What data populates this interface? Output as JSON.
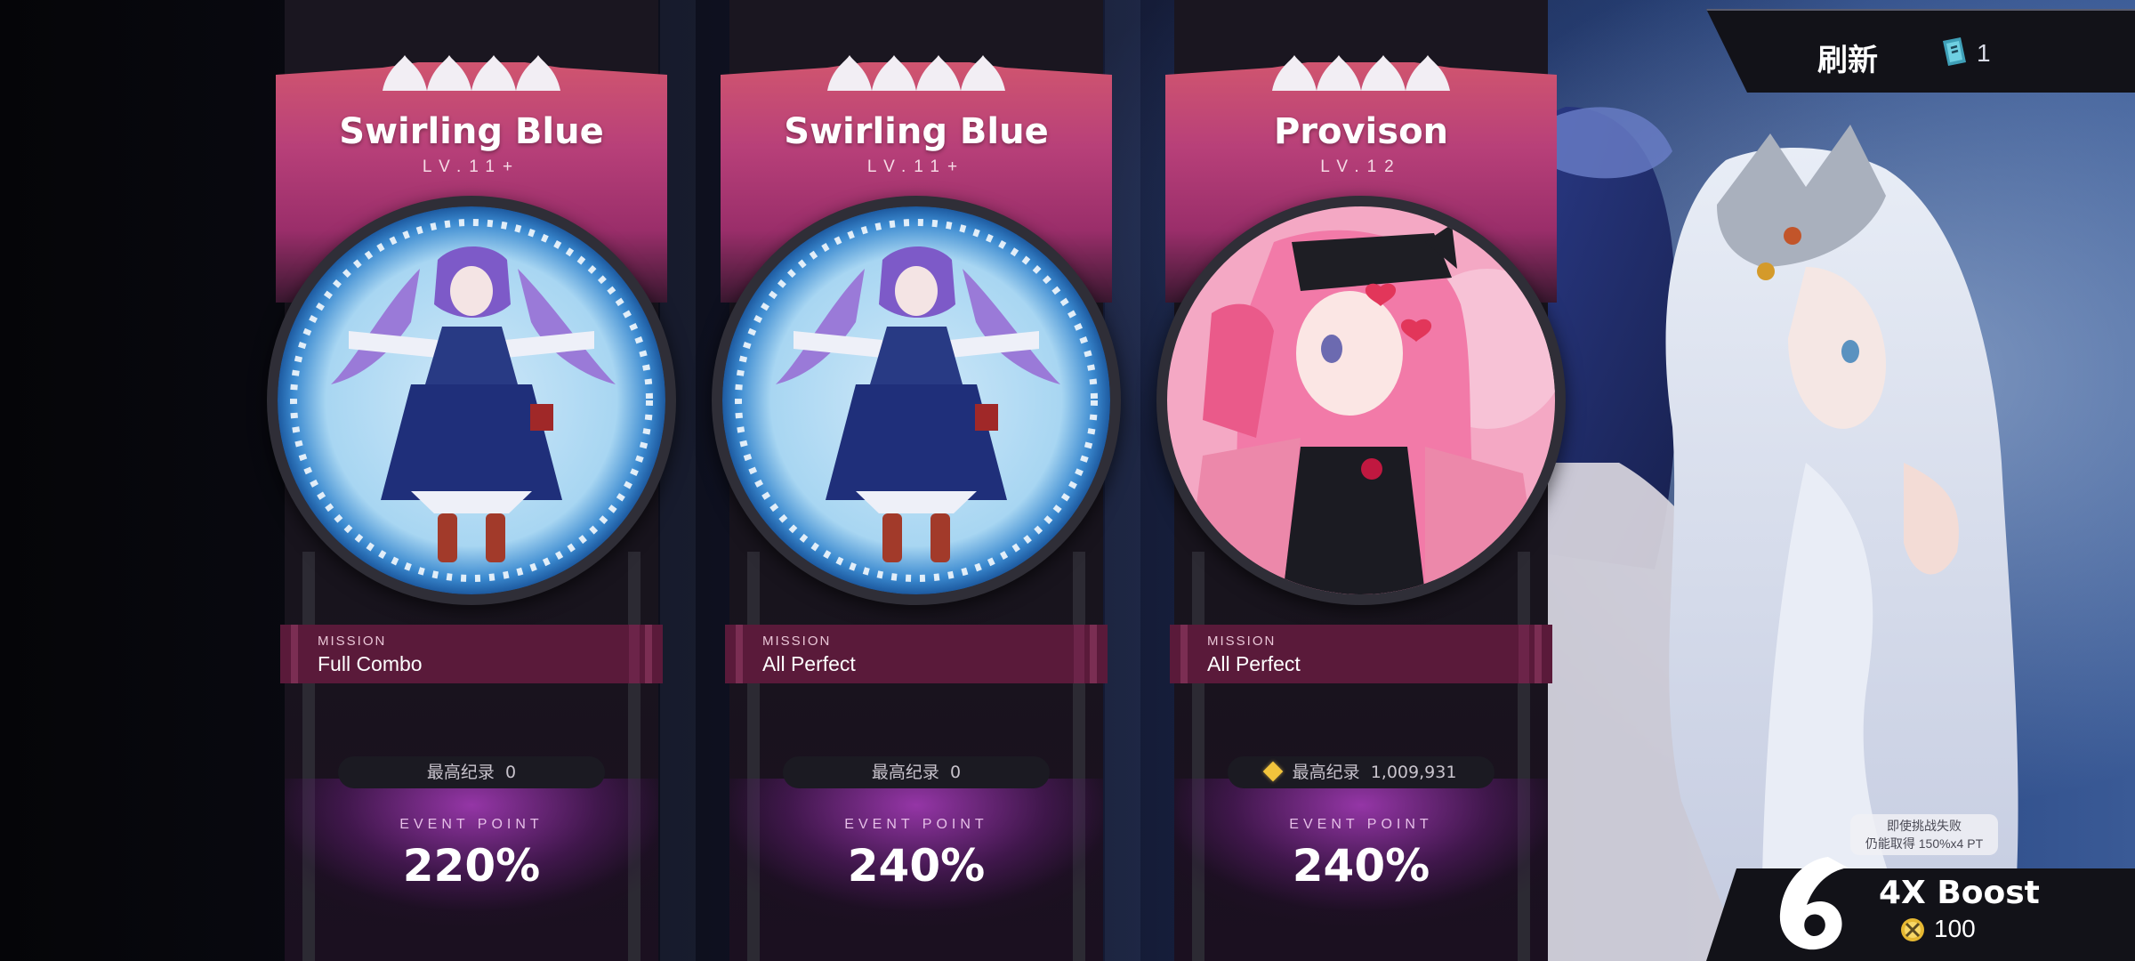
{
  "cards": [
    {
      "title": "Swirling Blue",
      "level": "LV.11+",
      "mission_label": "MISSION",
      "mission": "Full Combo",
      "best_label": "最高纪录",
      "best_score": "0",
      "has_best_icon": false,
      "ep_label": "EVENT POINT",
      "ep_value": "220%",
      "jacket": "swirling-blue"
    },
    {
      "title": "Swirling Blue",
      "level": "LV.11+",
      "mission_label": "MISSION",
      "mission": "All Perfect",
      "best_label": "最高纪录",
      "best_score": "0",
      "has_best_icon": false,
      "ep_label": "EVENT POINT",
      "ep_value": "240%",
      "jacket": "swirling-blue"
    },
    {
      "title": "Provison",
      "level": "LV.12",
      "mission_label": "MISSION",
      "mission": "All Perfect",
      "best_label": "最高纪录",
      "best_score": "1,009,931",
      "has_best_icon": true,
      "ep_label": "EVENT POINT",
      "ep_value": "240%",
      "jacket": "provison"
    }
  ],
  "refresh": {
    "label": "刷新",
    "count": "1",
    "icon": "refresh-ticket-icon"
  },
  "boost": {
    "tip_line1": "即使挑战失败",
    "tip_line2": "仍能取得 150%x4 PT",
    "title": "4X Boost",
    "cost": "100",
    "icon": "boost-emblem-icon",
    "cost_icon": "coin-icon"
  },
  "colors": {
    "banner": "#b84079",
    "mission_bg": "#5a1a3a",
    "glow": "#aa3cbe",
    "best_diamond": "#f2c43c"
  }
}
